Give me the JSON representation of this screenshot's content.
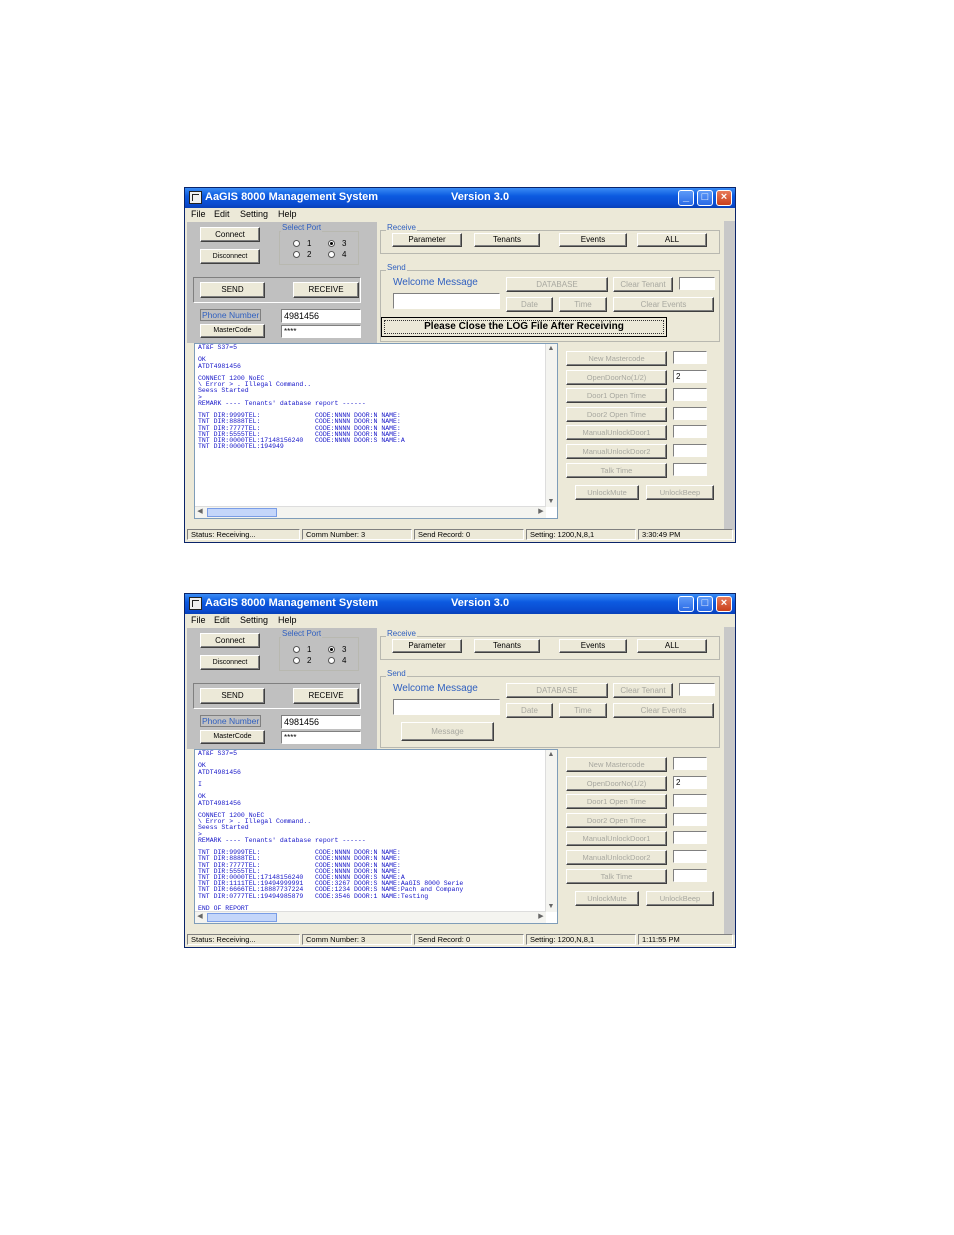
{
  "windows": [
    {
      "title": "AaGIS 8000 Management System",
      "version": "Version 3.0",
      "menu": [
        "File",
        "Edit",
        "Setting",
        "Help"
      ],
      "connect_label": "Connect",
      "disconnect_label": "Disconnect",
      "select_port_label": "Select Port",
      "ports": [
        "1",
        "2",
        "3",
        "4"
      ],
      "selected_port": "3",
      "send_label": "SEND",
      "receive_btn_label": "RECEIVE",
      "phone_number_label": "Phone Number",
      "phone_number_value": "4981456",
      "mastercode_label": "MasterCode",
      "mastercode_value": "****",
      "receive_group_label": "Receive",
      "receive_buttons": [
        "Parameter",
        "Tenants",
        "Events",
        "ALL"
      ],
      "send_group_label": "Send",
      "welcome_message_label": "Welcome Message",
      "database_label": "DATABASE",
      "clear_tenant_label": "Clear Tenant",
      "date_label": "Date",
      "time_label": "Time",
      "clear_events_label": "Clear Events",
      "message_label": "",
      "notice": "Please Close the LOG File After Receiving",
      "side_buttons": [
        "New Mastercode",
        "OpenDoorNo(1/2)",
        "Door1 Open Time",
        "Door2 Open Time",
        "ManualUnlockDoor1",
        "ManualUnlockDoor2",
        "Talk Time"
      ],
      "side_values": [
        "",
        "2",
        "",
        "",
        "",
        "",
        ""
      ],
      "unlock_mute_label": "UnlockMute",
      "unlock_beep_label": "UnlockBeep",
      "log_lines": [
        "AT&F S37=5",
        "",
        "OK",
        "ATDT4981456",
        "",
        "CONNECT 1200 NoEC",
        "\\ Error > . Illegal Command..",
        "Seess Started",
        ">",
        "REMARK ---- Tenants' database report ------",
        "",
        "TNT DIR:9999TEL:              CODE:NNNN DOOR:N NAME:",
        "TNT DIR:8888TEL:              CODE:NNNN DOOR:N NAME:",
        "TNT DIR:7777TEL:              CODE:NNNN DOOR:N NAME:",
        "TNT DIR:5555TEL:              CODE:NNNN DOOR:N NAME:",
        "TNT DIR:0000TEL:17148156240   CODE:NNNN DOOR:S NAME:A",
        "TNT DIR:0000TEL:194949"
      ],
      "status": [
        "Status: Receiving...",
        "Comm Number: 3",
        "Send Record: 0",
        "Setting: 1200,N,8,1",
        "3:30:49 PM"
      ]
    },
    {
      "title": "AaGIS 8000 Management System",
      "version": "Version 3.0",
      "menu": [
        "File",
        "Edit",
        "Setting",
        "Help"
      ],
      "connect_label": "Connect",
      "disconnect_label": "Disconnect",
      "select_port_label": "Select Port",
      "ports": [
        "1",
        "2",
        "3",
        "4"
      ],
      "selected_port": "3",
      "send_label": "SEND",
      "receive_btn_label": "RECEIVE",
      "phone_number_label": "Phone Number",
      "phone_number_value": "4981456",
      "mastercode_label": "MasterCode",
      "mastercode_value": "****",
      "receive_group_label": "Receive",
      "receive_buttons": [
        "Parameter",
        "Tenants",
        "Events",
        "ALL"
      ],
      "send_group_label": "Send",
      "welcome_message_label": "Welcome Message",
      "database_label": "DATABASE",
      "clear_tenant_label": "Clear Tenant",
      "date_label": "Date",
      "time_label": "Time",
      "clear_events_label": "Clear Events",
      "message_label": "Message",
      "notice": "",
      "side_buttons": [
        "New Mastercode",
        "OpenDoorNo(1/2)",
        "Door1 Open Time",
        "Door2 Open Time",
        "ManualUnlockDoor1",
        "ManualUnlockDoor2",
        "Talk Time"
      ],
      "side_values": [
        "",
        "2",
        "",
        "",
        "",
        "",
        ""
      ],
      "unlock_mute_label": "UnlockMute",
      "unlock_beep_label": "UnlockBeep",
      "log_lines": [
        "AT&F S37=5",
        "",
        "OK",
        "ATDT4981456",
        "",
        "I",
        "",
        "OK",
        "ATDT4981456",
        "",
        "CONNECT 1200 NoEC",
        "\\ Error > . Illegal Command..",
        "Seess Started",
        ">",
        "REMARK ---- Tenants' database report ------",
        "",
        "TNT DIR:9999TEL:              CODE:NNNN DOOR:N NAME:",
        "TNT DIR:8888TEL:              CODE:NNNN DOOR:N NAME:",
        "TNT DIR:7777TEL:              CODE:NNNN DOOR:N NAME:",
        "TNT DIR:5555TEL:              CODE:NNNN DOOR:N NAME:",
        "TNT DIR:0000TEL:17148156240   CODE:NNNN DOOR:S NAME:A",
        "TNT DIR:1111TEL:19494999991   CODE:3267 DOOR:S NAME:AaGIS 8000 Serie",
        "TNT DIR:6666TEL:18887737224   CODE:1234 DOOR:S NAME:Pach and Company",
        "TNT DIR:0777TEL:19494985879   CODE:3546 DOOR:1 NAME:Testing",
        "",
        "END OF REPORT"
      ],
      "status": [
        "Status: Receiving...",
        "Comm Number: 3",
        "Send Record: 0",
        "Setting: 1200,N,8,1",
        "1:11:55 PM"
      ]
    }
  ],
  "colors": {
    "titlebar": "#0c5ae0",
    "window_face": "#ece9d8",
    "log_text": "#1515c8",
    "label_blue": "#3060c0"
  }
}
